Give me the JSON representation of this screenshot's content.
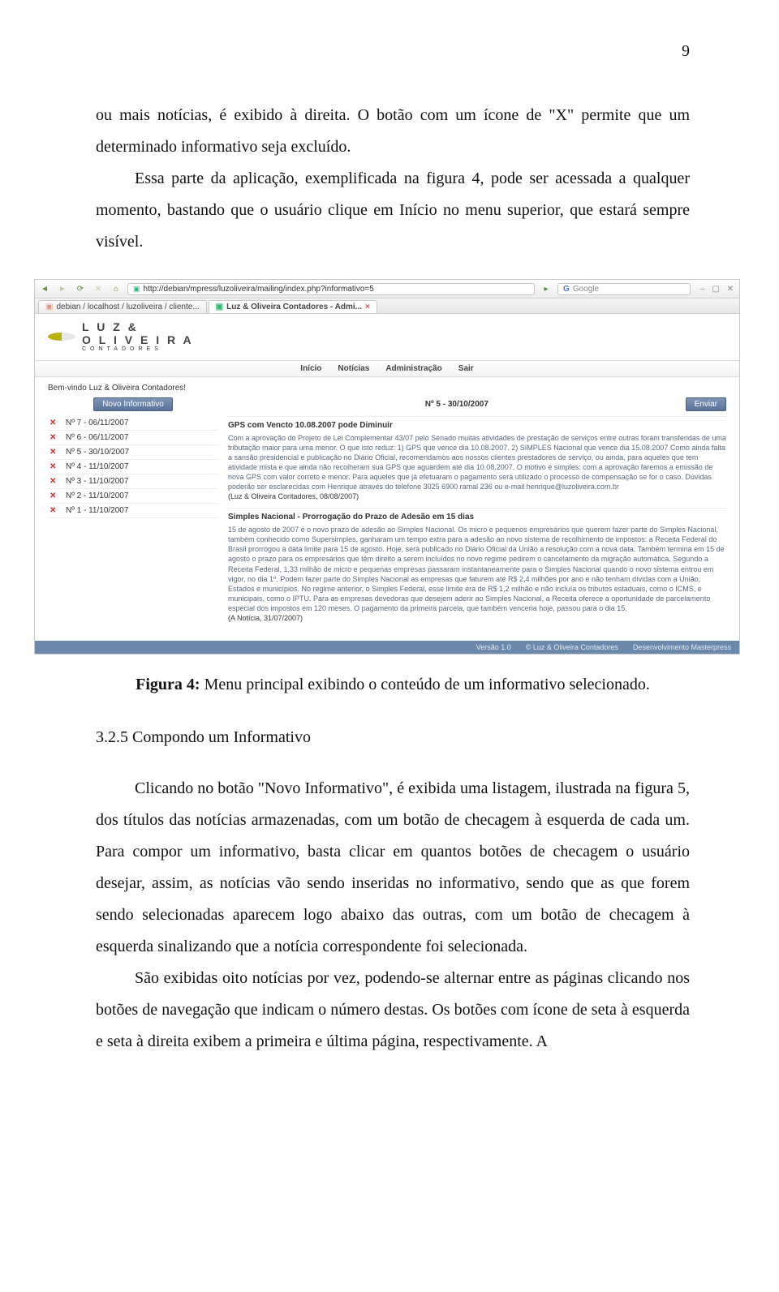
{
  "page": {
    "number": "9"
  },
  "para1": "ou mais notícias, é exibido à direita. O botão com um ícone de \"X\" permite que um determinado informativo seja excluído.",
  "para2": "Essa parte da aplicação, exemplificada na figura 4, pode ser acessada a qualquer momento, bastando que o usuário clique em Início no menu superior, que estará sempre visível.",
  "screenshot": {
    "url": "http://debian/mpress/luzoliveira/mailing/index.php?informativo=5",
    "search_placeholder": "Google",
    "tabs": [
      {
        "label": "debian / localhost / luzoliveira / cliente..."
      },
      {
        "label": "Luz & Oliveira Contadores - Admi..."
      }
    ],
    "brand": {
      "line1": "L U Z   &",
      "line2": "O L I V E I R A",
      "line3": "CONTADORES"
    },
    "nav": [
      "Início",
      "Notícias",
      "Administração",
      "Sair"
    ],
    "welcome": "Bem-vindo Luz & Oliveira Contadores!",
    "left": {
      "new_button": "Novo Informativo",
      "items": [
        "Nº 7 - 06/11/2007",
        "Nº 6 - 06/11/2007",
        "Nº 5 - 30/10/2007",
        "Nº 4 - 11/10/2007",
        "Nº 3 - 11/10/2007",
        "Nº 2 - 11/10/2007",
        "Nº 1 - 11/10/2007"
      ]
    },
    "right": {
      "title": "Nº 5 - 30/10/2007",
      "send_button": "Enviar",
      "articles": [
        {
          "title": "GPS com Vencto 10.08.2007 pode Diminuir",
          "body": "Com a aprovação do Projeto de Lei Complementar 43/07 pelo Senado muitas atividades de prestação de serviços entre outras foram transferidas de uma tributação maior para uma menor. O que isto reduz: 1) GPS que vence dia 10.08.2007. 2) SIMPLES Nacional que vence dia 15.08.2007 Como ainda falta a sansão presidencial e publicação no Diário Oficial, recomendamos aos nossos clientes prestadores de serviço, ou ainda, para aqueles que tem atividade mista e que ainda não recolheram sua GPS que aguardem até dia 10.08.2007. O motivo é simples: com a aprovação faremos a emissão de nova GPS com valor correto e menor. Para aqueles que já efetuaram o pagamento será utilizado o processo de compensação se for o caso. Dúvidas poderão ser esclarecidas com Henrique através do telefone 3025 6900 ramal 236 ou e-mail henrique@luzoliveira.com.br",
          "source": "(Luz & Oliveira Contadores, 08/08/2007)"
        },
        {
          "title": "Simples Nacional - Prorrogação do Prazo de Adesão em 15 dias",
          "body": "15 de agosto de 2007 é o novo prazo de adesão ao Simples Nacional. Os micro e pequenos empresários que querem fazer parte do Simples Nacional, também conhecido como Supersimples, ganharam um tempo extra para a adesão ao novo sistema de recolhimento de impostos: a Receita Federal do Brasil prorrogou a data limite para 15 de agosto. Hoje, será publicado no Diário Oficial da União a resolução com a nova data. Também termina em 15 de agosto o prazo para os empresários que têm direito a serem incluídos no novo regime pedirem o cancelamento da migração automática. Segundo a Receita Federal, 1,33 milhão de micro e pequenas empresas passaram instantaneamente para o Simples Nacional quando o novo sistema entrou em vigor, no dia 1º. Podem fazer parte do Simples Nacional as empresas que faturem até R$ 2,4 milhões por ano e não tenham dívidas com a União, Estados e municípios. No regime anterior, o Simples Federal, esse limite era de R$ 1,2 milhão e não incluía os tributos estaduais, como o ICMS, e municipais, como o IPTU. Para as empresas devedoras que desejem aderir ao Simples Nacional, a Receita oferece a oportunidade de parcelamento especial dos impostos em 120 meses. O pagamento da primeira parcela, que também venceria hoje, passou para o dia 15.",
          "source": "(A Notícia, 31/07/2007)"
        }
      ]
    },
    "footer": {
      "version": "Versão 1.0",
      "copyright": "© Luz & Oliveira Contadores",
      "dev": "Desenvolvimento Masterpress"
    }
  },
  "caption": {
    "label": "Figura 4:",
    "text": " Menu principal exibindo o conteúdo de um informativo selecionado."
  },
  "section_heading": "3.2.5 Compondo um Informativo",
  "para3": "Clicando no botão \"Novo Informativo\", é exibida uma listagem, ilustrada na figura 5, dos títulos das notícias armazenadas, com um botão de checagem à esquerda de cada um. Para compor um informativo, basta clicar em quantos botões de checagem o usuário desejar, assim, as notícias vão sendo inseridas no informativo, sendo que as que forem sendo selecionadas aparecem logo abaixo das outras, com um botão de checagem à esquerda sinalizando que a notícia correspondente foi selecionada.",
  "para4": "São exibidas oito notícias por vez, podendo-se alternar entre as páginas clicando nos botões de navegação que indicam o número destas. Os botões com ícone de seta à esquerda e seta à direita exibem a primeira e última página, respectivamente. A"
}
